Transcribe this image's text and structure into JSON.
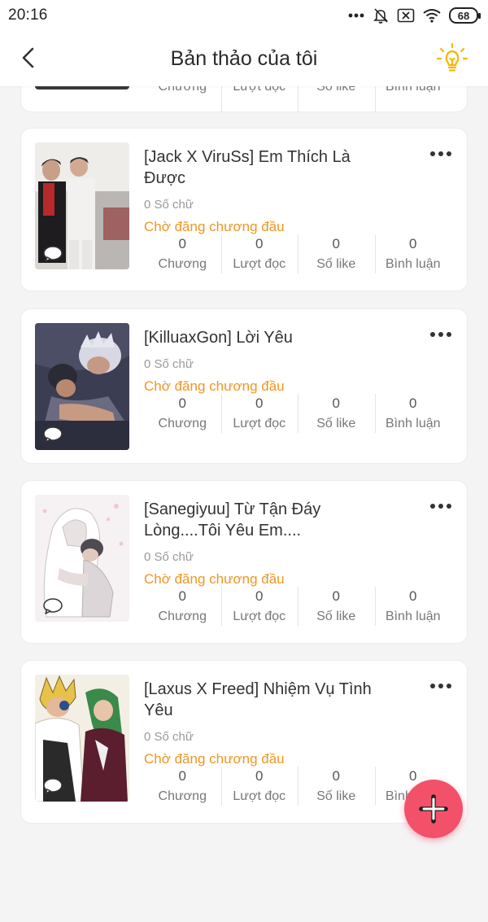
{
  "status_bar": {
    "time": "20:16",
    "battery": "68"
  },
  "header": {
    "title": "Bản thảo của tôi"
  },
  "stat_labels": {
    "chapters": "Chương",
    "reads": "Lượt đọc",
    "likes": "Số like",
    "comments": "Bình luận"
  },
  "drafts": [
    {
      "title": "",
      "word_count": "",
      "status": "",
      "stats": {
        "chapters": "",
        "reads": "",
        "likes": "",
        "comments": ""
      }
    },
    {
      "title": "[Jack X ViruSs] Em Thích Là Được",
      "word_count": "0 Số chữ",
      "status": "Chờ đăng chương đầu",
      "stats": {
        "chapters": "0",
        "reads": "0",
        "likes": "0",
        "comments": "0"
      }
    },
    {
      "title": "[KilluaxGon] Lời Yêu",
      "word_count": "0 Số chữ",
      "status": "Chờ đăng chương đầu",
      "stats": {
        "chapters": "0",
        "reads": "0",
        "likes": "0",
        "comments": "0"
      }
    },
    {
      "title": "[Sanegiyuu] Từ Tận Đáy Lòng....Tôi Yêu Em....",
      "word_count": "0 Số chữ",
      "status": "Chờ đăng chương đầu",
      "stats": {
        "chapters": "0",
        "reads": "0",
        "likes": "0",
        "comments": "0"
      }
    },
    {
      "title": "[Laxus X Freed] Nhiệm Vụ Tình Yêu",
      "word_count": "0 Số chữ",
      "status": "Chờ đăng chương đầu",
      "stats": {
        "chapters": "0",
        "reads": "0",
        "likes": "0",
        "comments": "0"
      }
    }
  ],
  "colors": {
    "accent_status": "#f19622",
    "fab": "#f3506a",
    "bulb": "#f5b800"
  },
  "icons": {
    "back": "chevron-left-icon",
    "tips": "lightbulb-icon",
    "more": "more-horizontal-icon",
    "add": "plus-icon",
    "cover_badge": "chat-bubble-icon"
  }
}
